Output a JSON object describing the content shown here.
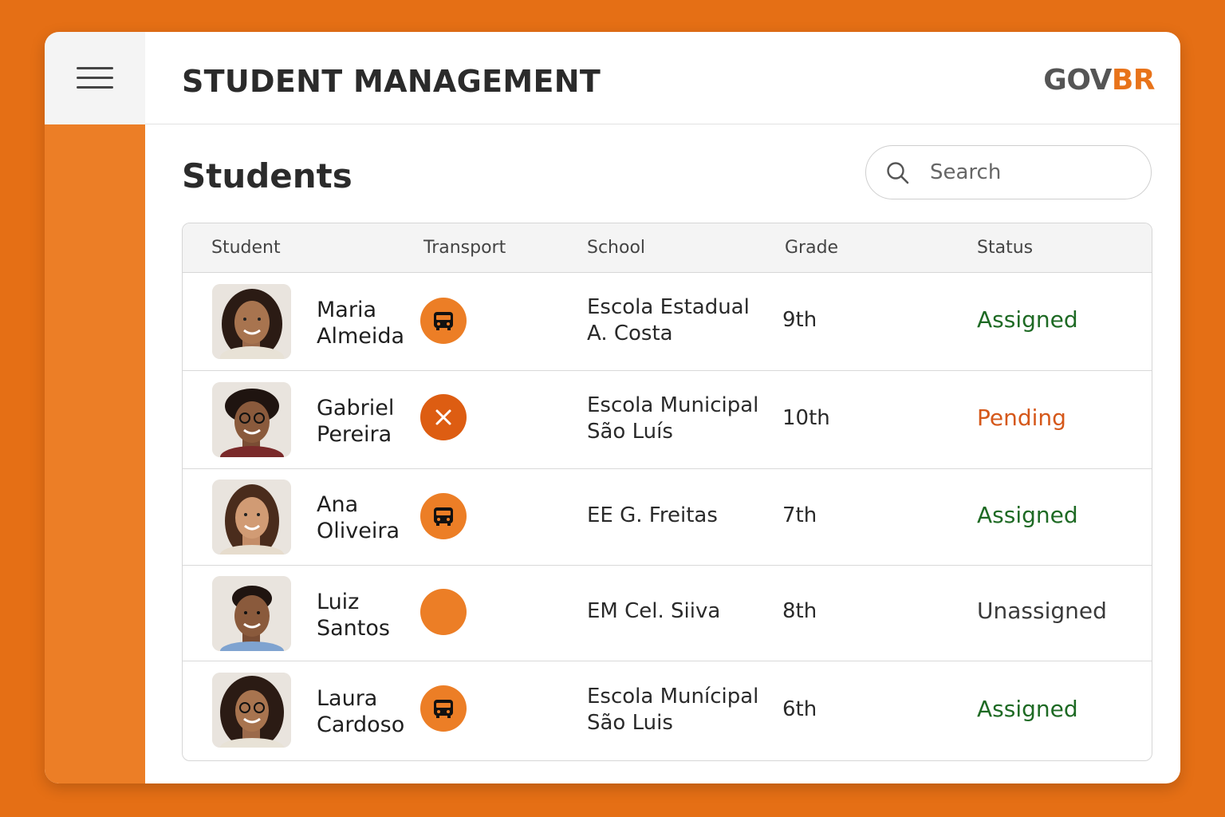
{
  "app": {
    "title": "STUDENT MANAGEMENT",
    "logo_part1": "GOV",
    "logo_part2": "BR"
  },
  "page": {
    "title": "Students"
  },
  "search": {
    "placeholder": "Search",
    "value": ""
  },
  "table": {
    "headers": {
      "student": "Student",
      "transport": "Transport",
      "school": "School",
      "grade": "Grade",
      "status": "Status"
    },
    "rows": [
      {
        "first_name": "Maria",
        "last_name": "Almeida",
        "transport_icon": "bus-icon",
        "school_line1": "Escola Estadual",
        "school_line2": "A. Costa",
        "grade": "9th",
        "status": "Assigned"
      },
      {
        "first_name": "Gabriel",
        "last_name": "Pereira",
        "transport_icon": "close-icon",
        "school_line1": "Escola Municipal",
        "school_line2": "São Luís",
        "grade": "10th",
        "status": "Pending"
      },
      {
        "first_name": "Ana",
        "last_name": "Oliveira",
        "transport_icon": "bus-icon",
        "school_line1": "EE G. Freitas",
        "school_line2": "",
        "grade": "7th",
        "status": "Assigned"
      },
      {
        "first_name": "Luiz",
        "last_name": "Santos",
        "transport_icon": "empty-circle-icon",
        "school_line1": "EM Cel. Siiva",
        "school_line2": "",
        "grade": "8th",
        "status": "Unassigned"
      },
      {
        "first_name": "Laura",
        "last_name": "Cardoso",
        "transport_icon": "bus-icon",
        "school_line1": "Escola Munícipal",
        "school_line2": "São Luis",
        "grade": "6th",
        "status": "Assigned"
      }
    ]
  },
  "colors": {
    "accent": "#ec7e26",
    "background": "#e56f15",
    "assigned": "#1e6a24",
    "pending": "#d5581a"
  }
}
